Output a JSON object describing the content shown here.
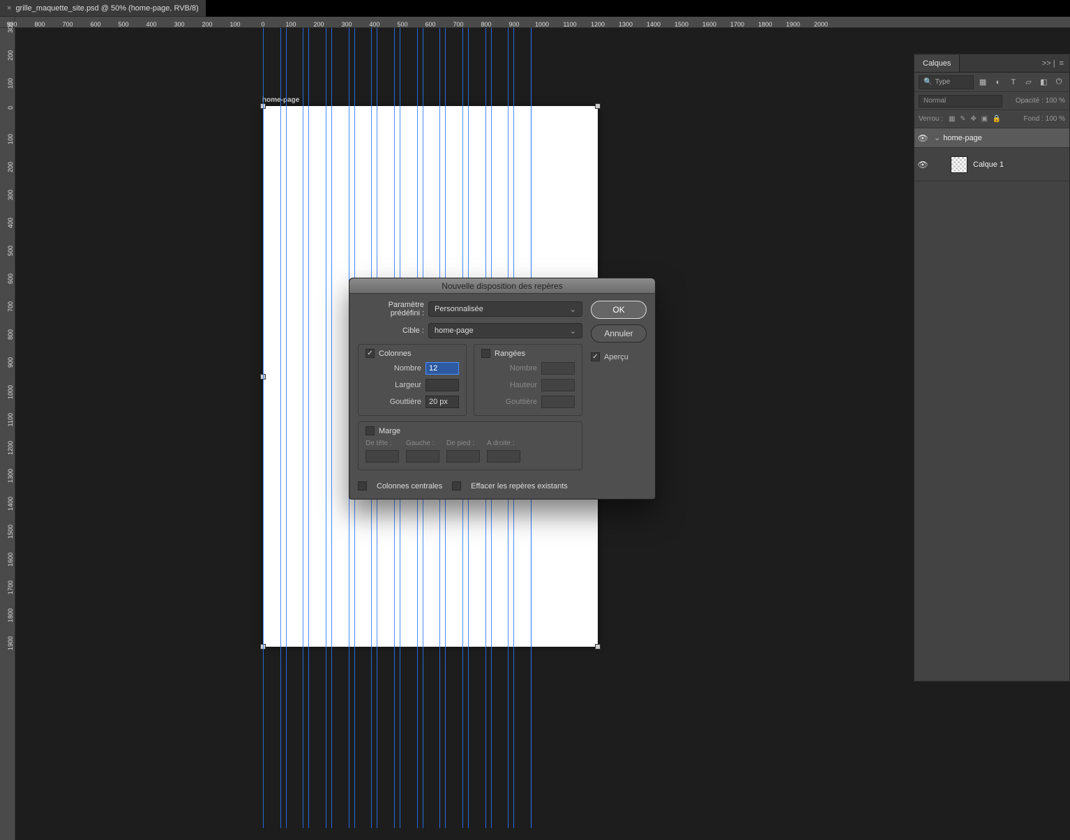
{
  "document_tab": {
    "close_glyph": "×",
    "title": "grille_maquette_site.psd @ 50% (home-page, RVB/8)"
  },
  "artboard": {
    "label": "home-page"
  },
  "ruler_h_ticks": [
    "900",
    "800",
    "700",
    "600",
    "500",
    "400",
    "300",
    "200",
    "100",
    "0",
    "100",
    "200",
    "300",
    "400",
    "500",
    "600",
    "700",
    "800",
    "900",
    "1000",
    "1100",
    "1200",
    "1300",
    "1400",
    "1500",
    "1600",
    "1700",
    "1800",
    "1900",
    "2000"
  ],
  "ruler_v_ticks": [
    "300",
    "200",
    "100",
    "0",
    "100",
    "200",
    "300",
    "400",
    "500",
    "600",
    "700",
    "800",
    "900",
    "1000",
    "1100",
    "1200",
    "1300",
    "1400",
    "1500",
    "1600",
    "1700",
    "1800",
    "1900"
  ],
  "layers_panel": {
    "tab": "Calques",
    "flyout_a": ">> |",
    "flyout_b": "≡",
    "kind_placeholder": "Type",
    "blend_label": "Normal",
    "opacity_label": "Opacité :",
    "opacity_value": "100 %",
    "lock_label": "Verrou :",
    "fill_label": "Fond :",
    "fill_value": "100 %",
    "layers": [
      {
        "name": "home-page",
        "group": true,
        "selected": true
      },
      {
        "name": "Calque 1",
        "group": false,
        "selected": false
      }
    ]
  },
  "dialog": {
    "title": "Nouvelle disposition des repères",
    "preset_label": "Paramètre prédéfini :",
    "preset_value": "Personnalisée",
    "target_label": "Cible :",
    "target_value": "home-page",
    "columns": {
      "head": "Colonnes",
      "checked": true,
      "count_label": "Nombre",
      "count_value": "12",
      "width_label": "Largeur",
      "width_value": "",
      "gutter_label": "Gouttière",
      "gutter_value": "20 px"
    },
    "rows": {
      "head": "Rangées",
      "checked": false,
      "count_label": "Nombre",
      "height_label": "Hauteur",
      "gutter_label": "Gouttière"
    },
    "margin": {
      "head": "Marge",
      "checked": false,
      "top": "De tête :",
      "left": "Gauche :",
      "bottom": "De pied :",
      "right": "A droite :"
    },
    "centered_cols": "Colonnes centrales",
    "clear_guides": "Effacer les repères existants",
    "ok": "OK",
    "cancel": "Annuler",
    "preview": "Aperçu"
  }
}
